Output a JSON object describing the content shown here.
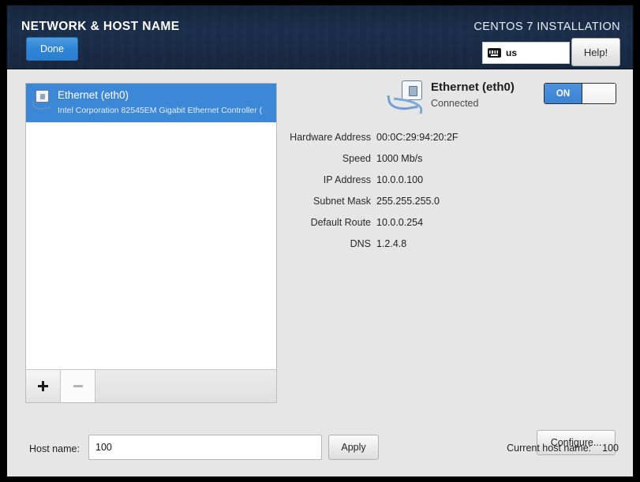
{
  "header": {
    "spoke_title": "NETWORK & HOST NAME",
    "done_label": "Done",
    "install_title": "CENTOS 7 INSTALLATION",
    "keyboard_layout": "us",
    "keyboard_icon": "keyboard-icon",
    "help_label": "Help!",
    "accent_blue": "#2f85d6",
    "header_navy": "#1b2f4c"
  },
  "devices": {
    "items": [
      {
        "name": "Ethernet (eth0)",
        "description": "Intel Corporation 82545EM Gigabit Ethernet Controller (",
        "icon": "ethernet-icon",
        "selected": true
      }
    ],
    "toolbar": {
      "add_label": "+",
      "remove_label": "−"
    }
  },
  "detail": {
    "icon": "ethernet-icon",
    "name": "Ethernet (eth0)",
    "status": "Connected",
    "toggle": {
      "on_label": "ON",
      "state": "on"
    },
    "rows": [
      {
        "label": "Hardware Address",
        "value": "00:0C:29:94:20:2F"
      },
      {
        "label": "Speed",
        "value": "1000 Mb/s"
      },
      {
        "label": "IP Address",
        "value": "10.0.0.100"
      },
      {
        "label": "Subnet Mask",
        "value": "255.255.255.0"
      },
      {
        "label": "Default Route",
        "value": "10.0.0.254"
      },
      {
        "label": "DNS",
        "value": "1.2.4.8"
      }
    ],
    "configure_label": "Configure..."
  },
  "hostname": {
    "label": "Host name:",
    "value": "100",
    "placeholder": "",
    "apply_label": "Apply",
    "current_label": "Current host name:",
    "current_value": "100"
  }
}
